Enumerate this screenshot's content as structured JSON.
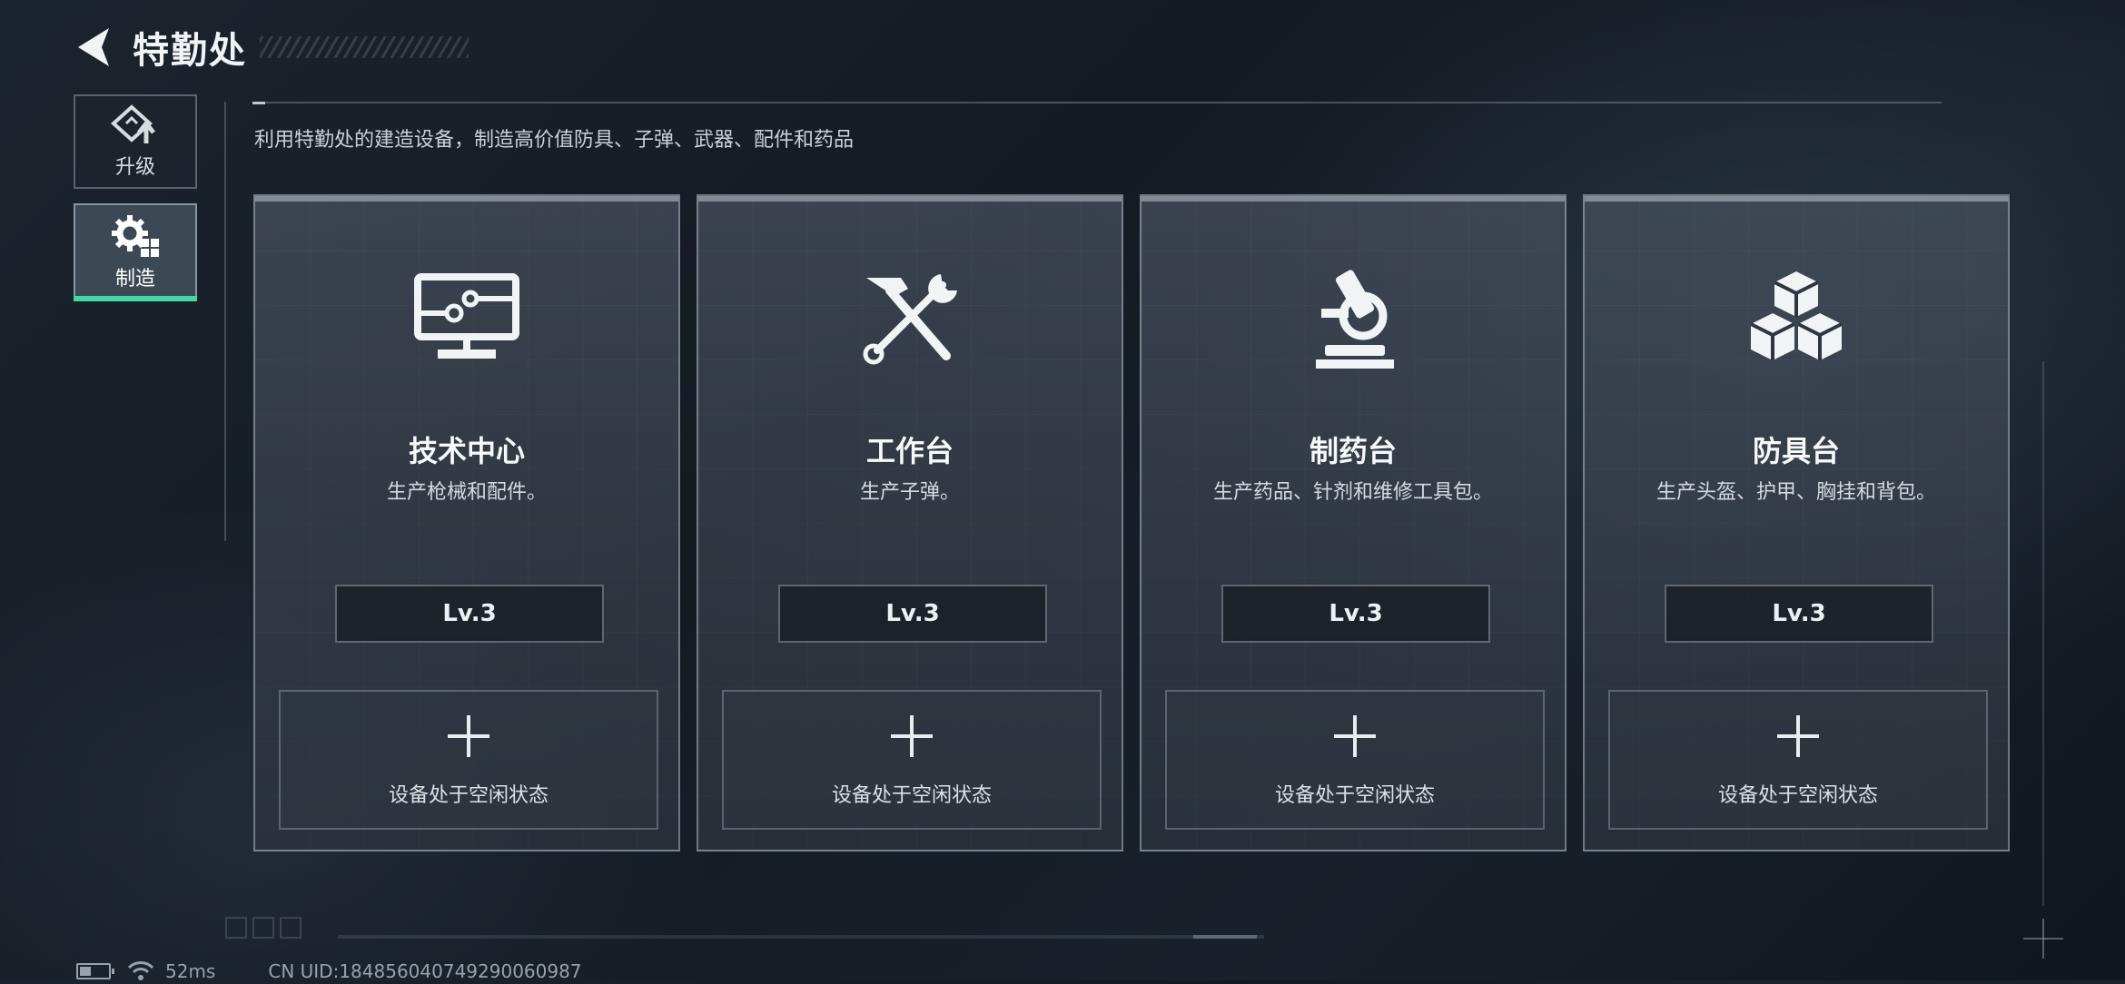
{
  "header": {
    "title": "特勤处"
  },
  "sidebar": {
    "items": [
      {
        "label": "升级",
        "icon": "upgrade-icon",
        "active": false
      },
      {
        "label": "制造",
        "icon": "gear-craft-icon",
        "active": true
      }
    ],
    "active_color": "#43d7a1"
  },
  "description": "利用特勤处的建造设备，制造高价值防具、子弹、武器、配件和药品",
  "stations": [
    {
      "name": "技术中心",
      "desc": "生产枪械和配件。",
      "level": "Lv.3",
      "slot": "设备处于空闲状态",
      "icon": "monitor-icon"
    },
    {
      "name": "工作台",
      "desc": "生产子弹。",
      "level": "Lv.3",
      "slot": "设备处于空闲状态",
      "icon": "hammer-wrench-icon"
    },
    {
      "name": "制药台",
      "desc": "生产药品、针剂和维修工具包。",
      "level": "Lv.3",
      "slot": "设备处于空闲状态",
      "icon": "microscope-icon"
    },
    {
      "name": "防具台",
      "desc": "生产头盔、护甲、胸挂和背包。",
      "level": "Lv.3",
      "slot": "设备处于空闲状态",
      "icon": "boxes-icon"
    }
  ],
  "status": {
    "ping": "52ms",
    "uid": "CN UID:1848560407492900609​87"
  }
}
